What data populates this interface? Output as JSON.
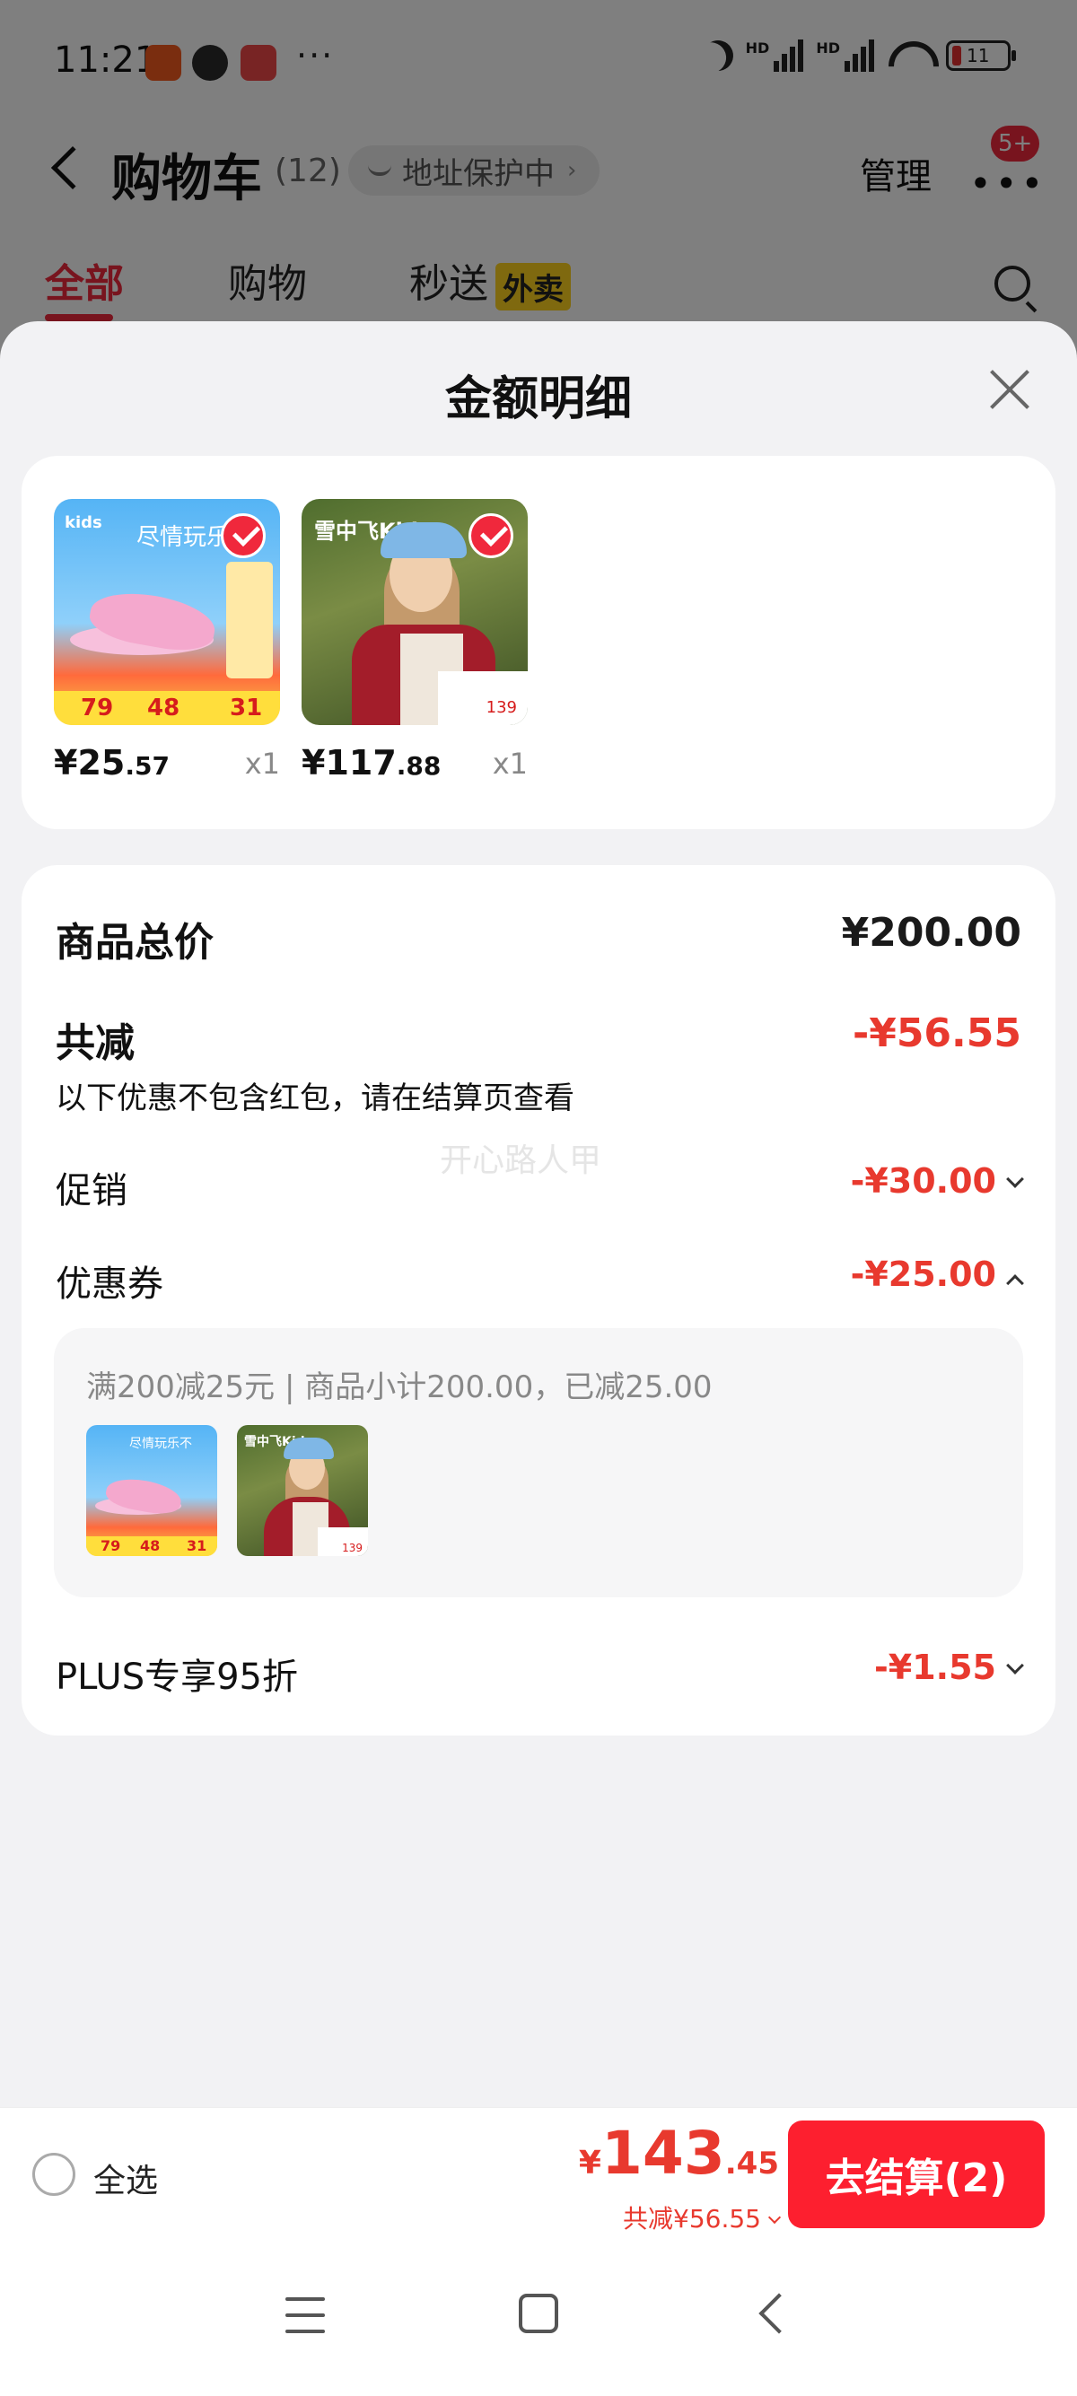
{
  "status_bar": {
    "time": "11:21",
    "more": "···",
    "hd_label": "HD",
    "battery_level": "11"
  },
  "header": {
    "title": "购物车",
    "count": "(12)",
    "address_pill": "地址保护中",
    "manage": "管理",
    "badge": "5+"
  },
  "tabs": [
    {
      "label": "全部"
    },
    {
      "label": "购物"
    },
    {
      "label": "秒送"
    }
  ],
  "tab_tag": "外卖",
  "sheet": {
    "title": "金额明细"
  },
  "products": [
    {
      "brand": "kids",
      "slogan": "尽情玩乐不",
      "price_int": "¥25",
      "price_dec": ".57",
      "qty": "x1",
      "tag_a": "79",
      "tag_b": "48",
      "tag_c": "31"
    },
    {
      "brand": "雪中飞Kids",
      "price_int": "¥117",
      "price_dec": ".88",
      "qty": "x1",
      "tag": "139"
    }
  ],
  "details": {
    "subtotal_label": "商品总价",
    "subtotal_value": "¥200.00",
    "discount_label": "共减",
    "discount_value": "-¥56.55",
    "discount_note": "以下优惠不包含红包，请在结算页查看",
    "watermark": "开心路人甲",
    "promo_label": "促销",
    "promo_value": "-¥30.00",
    "coupon_label": "优惠券",
    "coupon_value": "-¥25.00",
    "coupon_desc": "满200减25元 | 商品小计200.00，已减25.00",
    "plus_label": "PLUS专享95折",
    "plus_value": "-¥1.55"
  },
  "bottom_bar": {
    "select_all": "全选",
    "currency": "¥",
    "total_int": "143",
    "total_dec": ".45",
    "saved": "共减¥56.55",
    "checkout": "去结算(2)"
  },
  "colors": {
    "accent_red": "#f0283c",
    "price_red": "#e8392e",
    "checkout_bg": "#fd1f2f",
    "tag_yellow": "#ffd21e"
  }
}
